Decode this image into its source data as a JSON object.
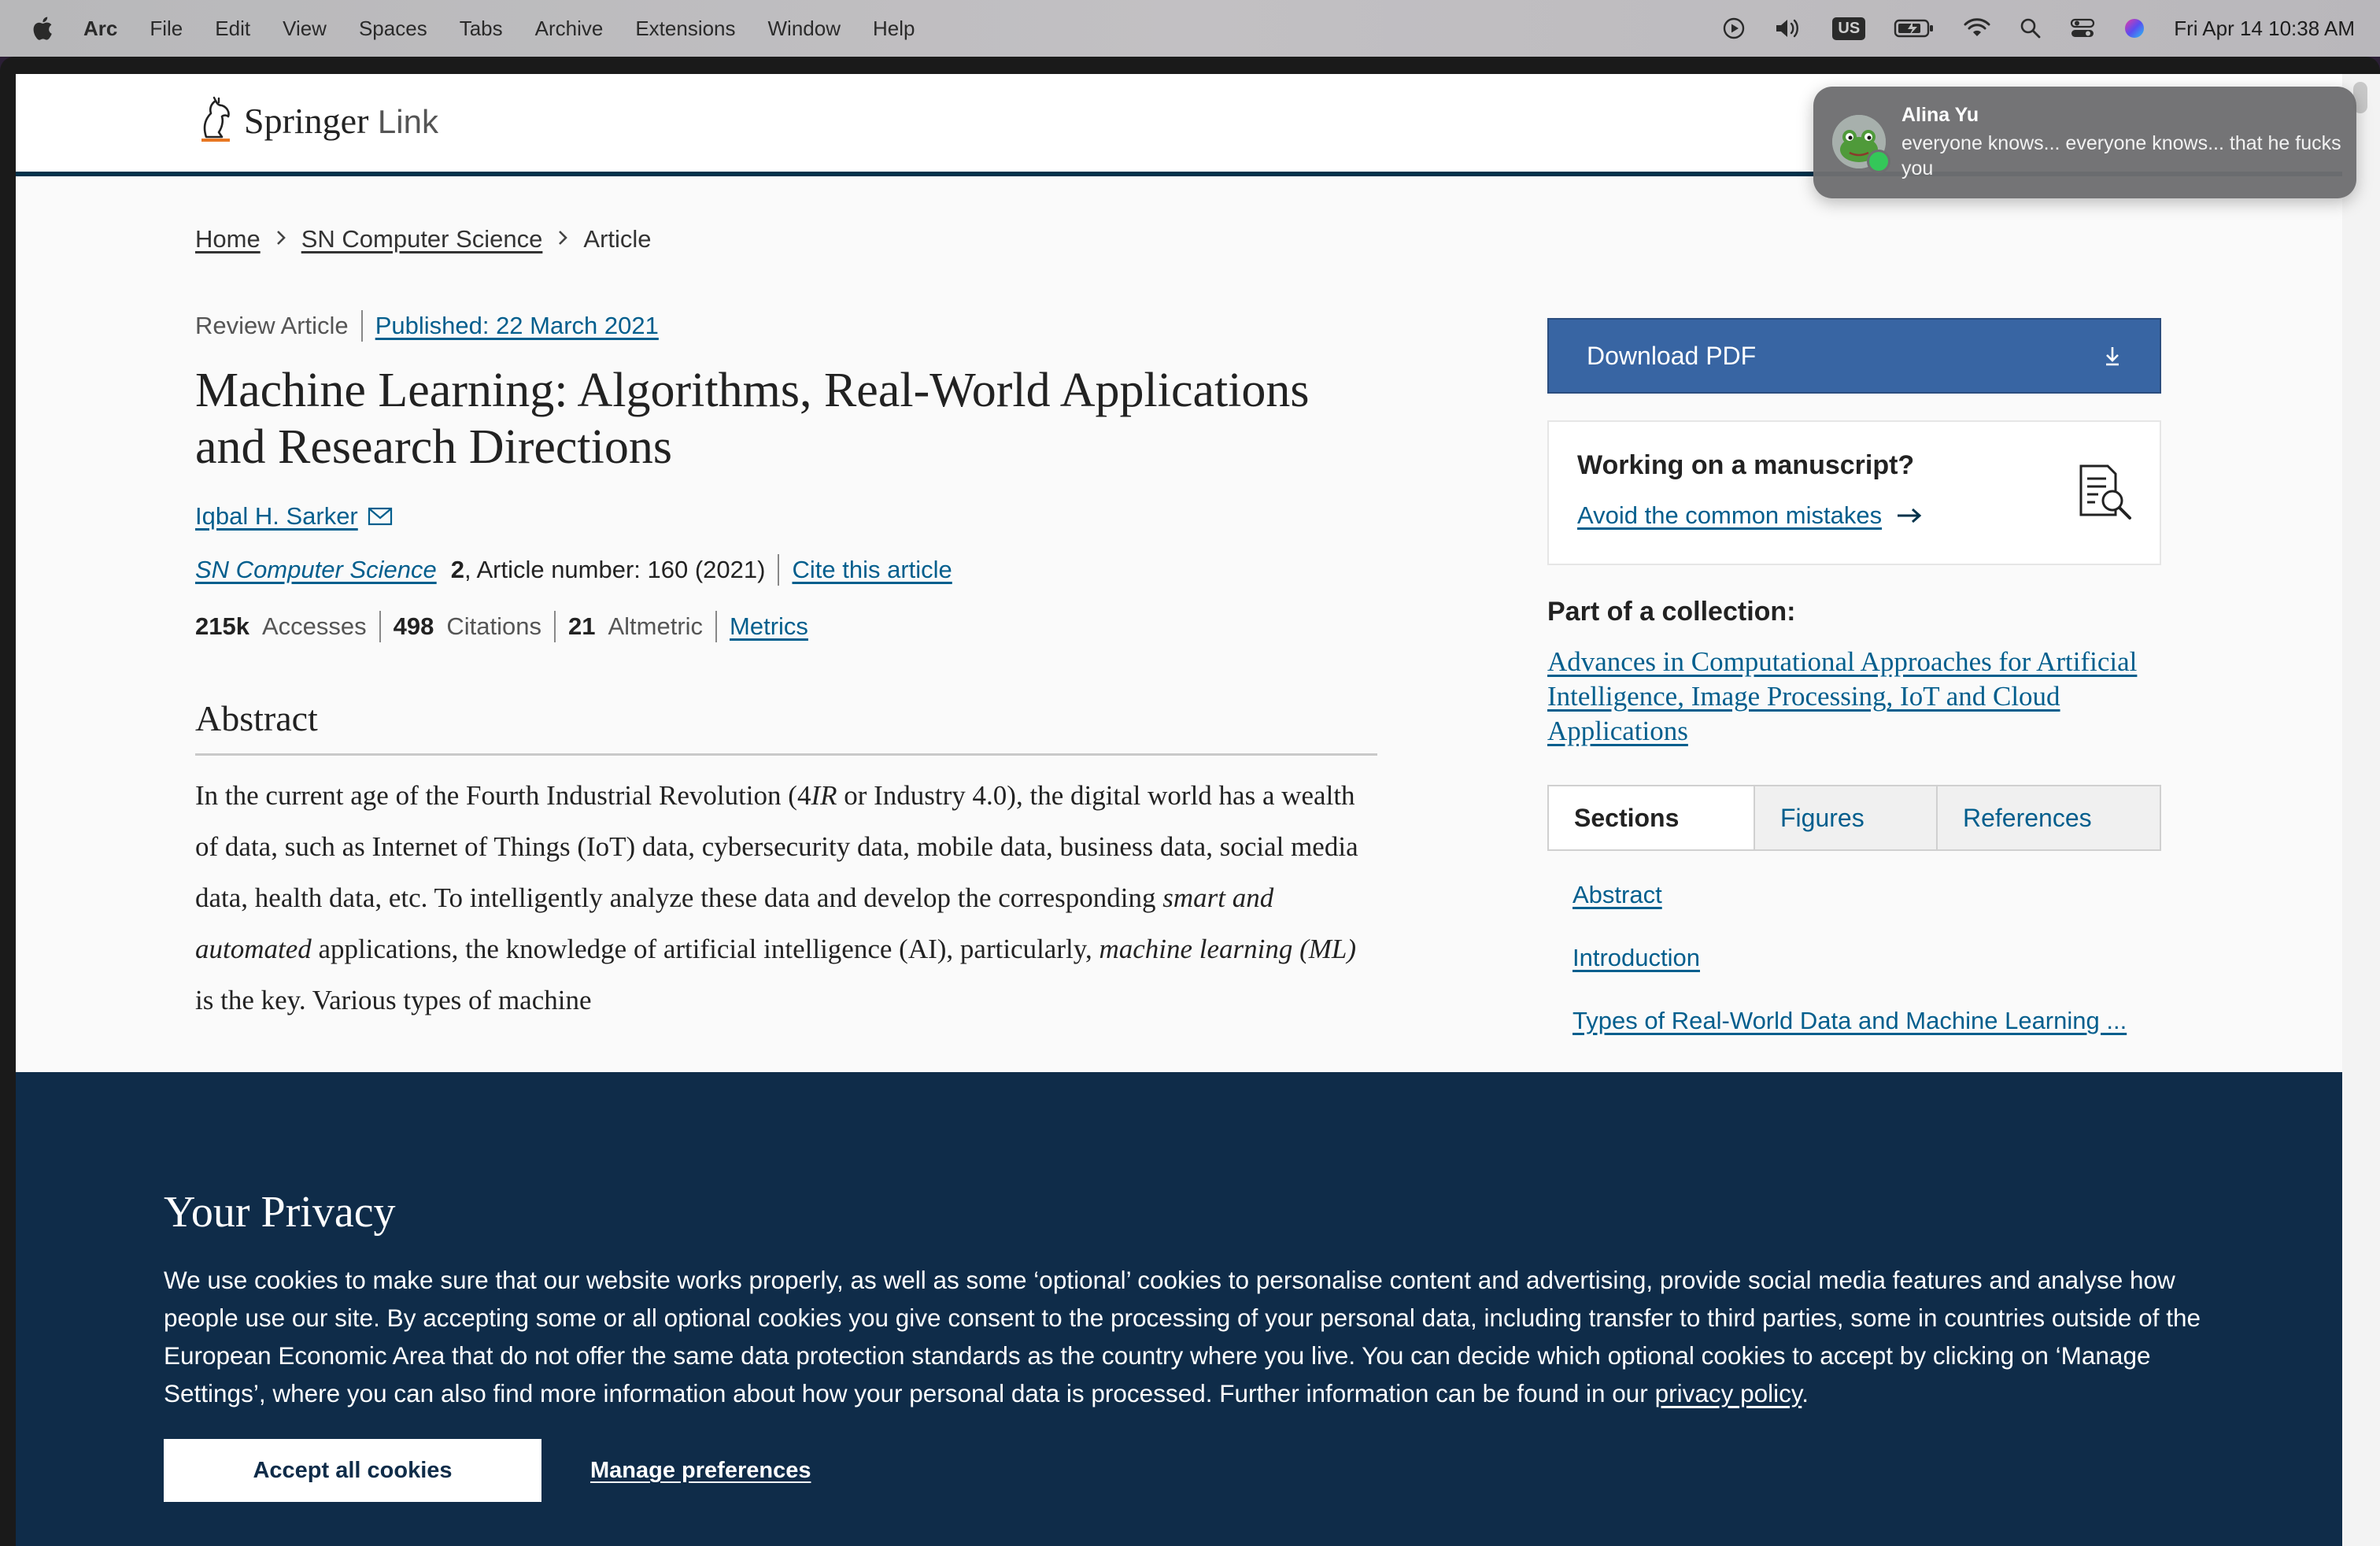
{
  "menubar": {
    "app_name": "Arc",
    "items": [
      "File",
      "Edit",
      "View",
      "Spaces",
      "Tabs",
      "Archive",
      "Extensions",
      "Window",
      "Help"
    ],
    "keyboard_layout": "US",
    "datetime": "Fri Apr 14  10:38 AM"
  },
  "site": {
    "logo_primary": "Springer",
    "logo_secondary": "Link"
  },
  "breadcrumb": {
    "home": "Home",
    "journal": "SN Computer Science",
    "current": "Article"
  },
  "article": {
    "type": "Review Article",
    "published": "Published: 22 March 2021",
    "title": "Machine Learning: Algorithms, Real-World Applications and Research Directions",
    "author": "Iqbal H. Sarker",
    "journal": "SN Computer Science",
    "volume": "2",
    "article_number": ", Article number: 160 (2021)",
    "cite": "Cite this article",
    "accesses_value": "215k",
    "accesses_label": "Accesses",
    "citations_value": "498",
    "citations_label": "Citations",
    "altmetric_value": "21",
    "altmetric_label": "Altmetric",
    "metrics_link": "Metrics"
  },
  "abstract": {
    "heading": "Abstract",
    "p1": "In the current age of the Fourth Industrial Revolution (4",
    "p1_italic": "IR",
    "p2": " or Industry 4.0), the digital world has a wealth of data, such as Internet of Things (IoT) data, cybersecurity data, mobile data, business data, social media data, health data, etc. To intelligently analyze these data and develop the corresponding ",
    "p2_italic": "smart and automated",
    "p3": " applications, the knowledge of artificial intelligence (AI), particularly, ",
    "p3_italic": "machine learning (ML)",
    "p4": " is the key. Various types of machine"
  },
  "sidebar": {
    "download_pdf": "Download PDF",
    "manuscript_heading": "Working on a manuscript?",
    "manuscript_link": "Avoid the common mistakes",
    "collection_heading": "Part of a collection:",
    "collection_link": "Advances in Computational Approaches for Artificial Intelligence, Image Processing, IoT and Cloud Applications",
    "tabs": [
      "Sections",
      "Figures",
      "References"
    ],
    "toc": [
      "Abstract",
      "Introduction",
      "Types of Real-World Data and Machine Learning ..."
    ]
  },
  "cookie": {
    "heading": "Your Privacy",
    "body": "We use cookies to make sure that our website works properly, as well as some ‘optional’ cookies to personalise content and advertising, provide social media features and analyse how people use our site. By accepting some or all optional cookies you give consent to the processing of your personal data, including transfer to third parties, some in countries outside of the European Economic Area that do not offer the same data protection standards as the country where you live. You can decide which optional cookies to accept by clicking on ‘Manage Settings’, where you can also find more information about how your personal data is processed. Further information can be found in our ",
    "privacy_link": "privacy policy",
    "body_end": ".",
    "accept_button": "Accept all cookies",
    "manage_link": "Manage preferences"
  },
  "notification": {
    "sender": "Alina Yu",
    "message": "everyone knows... everyone knows... that he fucks you"
  },
  "colors": {
    "link": "#025e8d",
    "download_button": "#3865a3",
    "cookie_banner": "#0f2c49",
    "header_rule": "#01324b"
  }
}
